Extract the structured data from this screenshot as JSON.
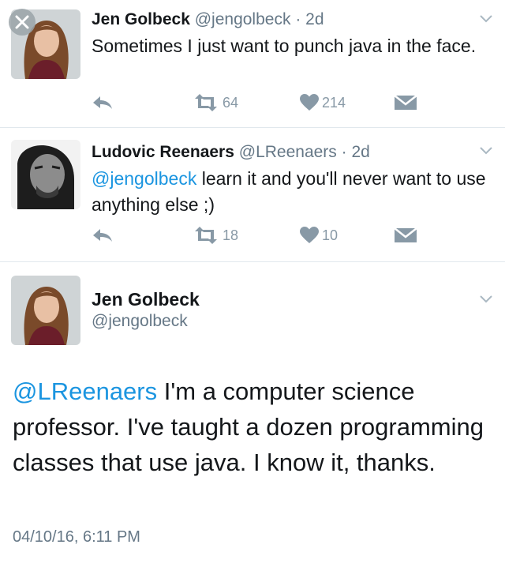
{
  "tweets": [
    {
      "name": "Jen Golbeck",
      "handle": "@jengolbeck",
      "dot": "·",
      "time": "2d",
      "text": "Sometimes I just want to punch java in the face.",
      "retweets": "64",
      "likes": "214"
    },
    {
      "name": "Ludovic Reenaers",
      "handle": "@LReenaers",
      "dot": "·",
      "time": "2d",
      "mention": "@jengolbeck",
      "text": " learn it and you'll never want to use anything else ;)",
      "retweets": "18",
      "likes": "10"
    }
  ],
  "detail": {
    "name": "Jen Golbeck",
    "handle": "@jengolbeck",
    "mention": "@LReenaers",
    "text": " I'm a computer science professor. I've taught a dozen programming classes that use java. I know it, thanks.",
    "timestamp": "04/10/16, 6:11 PM"
  },
  "icons": {
    "reply": "reply-icon",
    "retweet": "retweet-icon",
    "like": "heart-icon",
    "dm": "envelope-icon",
    "caret": "chevron-down-icon",
    "close": "close-icon"
  },
  "colors": {
    "mention": "#1b95e0",
    "secondary_text": "#657786",
    "action_icon": "#8899a6",
    "divider": "#e1e8ed"
  }
}
